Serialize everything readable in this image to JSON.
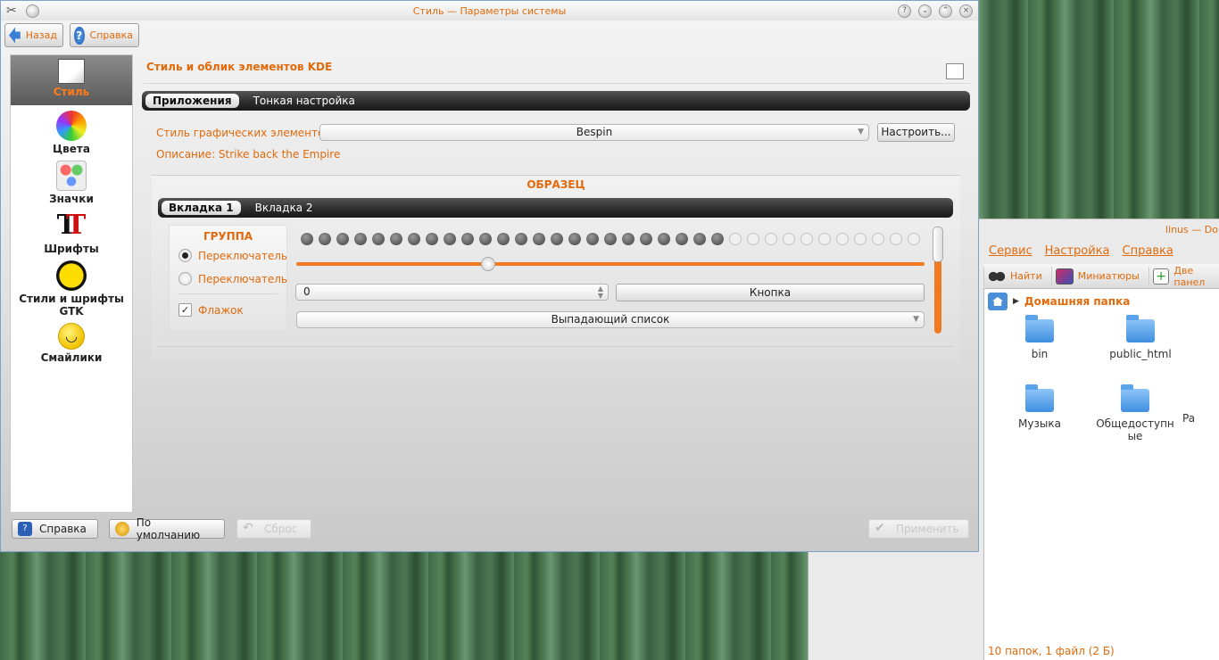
{
  "colors": {
    "accent": "#e06a0c",
    "window_border": "#7fa3c7"
  },
  "main_window": {
    "title": "Стиль — Параметры системы",
    "nav": {
      "back": "Назад",
      "help": "Справка"
    },
    "sidebar": [
      {
        "label": "Стиль",
        "icon": "style-icon",
        "active": true
      },
      {
        "label": "Цвета",
        "icon": "colors-icon"
      },
      {
        "label": "Значки",
        "icon": "icons-icon"
      },
      {
        "label": "Шрифты",
        "icon": "fonts-icon"
      },
      {
        "label": "Стили и шрифты GTK",
        "icon": "gtk-icon"
      },
      {
        "label": "Смайлики",
        "icon": "smiley-icon"
      }
    ],
    "page_title": "Стиль и облик элементов KDE",
    "tabs": [
      "Приложения",
      "Тонкая настройка"
    ],
    "widget_style_label": "Стиль графических элементов:",
    "widget_style_value": "Bespin",
    "configure_button": "Настроить...",
    "description": "Описание: Strike back the Empire",
    "preview": {
      "title": "ОБРАЗЕЦ",
      "tabs": [
        "Вкладка 1",
        "Вкладка 2"
      ],
      "group_title": "ГРУППА",
      "radio1": "Переключатель",
      "radio2": "Переключатель",
      "checkbox": "Флажок",
      "progress": {
        "filled": 24,
        "total": 35
      },
      "slider_value_fraction": 0.3,
      "spin_value": "0",
      "button": "Кнопка",
      "combo": "Выпадающий список"
    },
    "bottom": {
      "help": "Справка",
      "defaults": "По умолчанию",
      "reset": "Сброс",
      "apply": "Применить"
    }
  },
  "dolphin": {
    "title": "linus — Dolp",
    "menu": [
      "Сервис",
      "Настройка",
      "Справка"
    ],
    "toolbar": [
      "Найти",
      "Миниатюры",
      "Две панел"
    ],
    "breadcrumb": "Домашняя папка",
    "files": [
      {
        "name": "bin",
        "type": "folder"
      },
      {
        "name": "public_html",
        "type": "folder-web"
      },
      {
        "name": "Музыка",
        "type": "folder"
      },
      {
        "name": "Общедоступные",
        "type": "folder"
      },
      {
        "name": "Pa",
        "type": "folder"
      }
    ],
    "status": "10 папок, 1 файл (2 Б)"
  }
}
